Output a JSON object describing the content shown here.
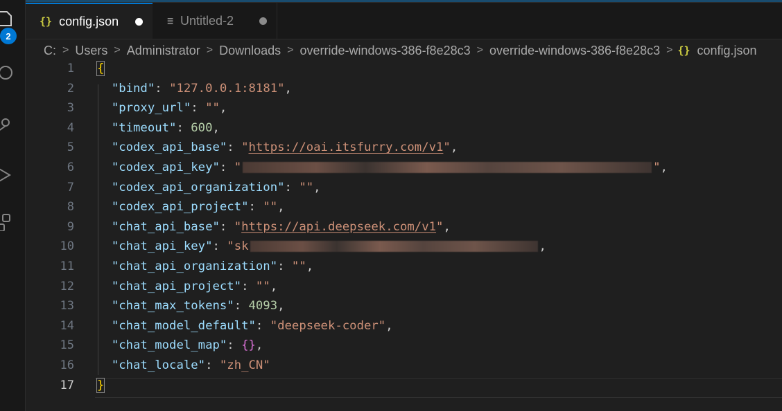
{
  "activity_bar": {
    "icons": [
      "explorer-icon",
      "search-icon",
      "source-control-icon",
      "run-debug-icon",
      "extensions-icon"
    ],
    "badge": "2",
    "accent_color": "#0078d4"
  },
  "tabs": [
    {
      "icon": "{}",
      "label": "config.json",
      "icon_color": "#cbcb41",
      "modified": true
    },
    {
      "icon": "≡",
      "label": "Untitled-2",
      "icon_color": "#8b8b8b",
      "modified": true
    }
  ],
  "breadcrumb": {
    "items": [
      "C:",
      "Users",
      "Administrator",
      "Downloads",
      "override-windows-386-f8e28c3",
      "override-windows-386-f8e28c3"
    ],
    "file_icon": "{}",
    "file": "config.json"
  },
  "editor": {
    "current_line": 17,
    "line_numbers": [
      "1",
      "2",
      "3",
      "4",
      "5",
      "6",
      "7",
      "8",
      "9",
      "10",
      "11",
      "12",
      "13",
      "14",
      "15",
      "16",
      "17"
    ],
    "open_brace": "{",
    "close_brace": "}",
    "entries": [
      {
        "key": "\"bind\"",
        "value": "\"127.0.0.1:8181\"",
        "type": "string"
      },
      {
        "key": "\"proxy_url\"",
        "value": "\"\"",
        "type": "string"
      },
      {
        "key": "\"timeout\"",
        "value": "600",
        "type": "number"
      },
      {
        "key": "\"codex_api_base\"",
        "value": "\"https://oai.itsfurry.com/v1\"",
        "type": "url"
      },
      {
        "key": "\"codex_api_key\"",
        "value_prefix": "\"",
        "value_suffix": "\"",
        "type": "redacted"
      },
      {
        "key": "\"codex_api_organization\"",
        "value": "\"\"",
        "type": "string"
      },
      {
        "key": "\"codex_api_project\"",
        "value": "\"\"",
        "type": "string"
      },
      {
        "key": "\"chat_api_base\"",
        "value": "\"https://api.deepseek.com/v1\"",
        "type": "url"
      },
      {
        "key": "\"chat_api_key\"",
        "value_prefix": "\"sk",
        "value_suffix": "",
        "type": "redacted"
      },
      {
        "key": "\"chat_api_organization\"",
        "value": "\"\"",
        "type": "string"
      },
      {
        "key": "\"chat_api_project\"",
        "value": "\"\"",
        "type": "string"
      },
      {
        "key": "\"chat_max_tokens\"",
        "value": "4093",
        "type": "number"
      },
      {
        "key": "\"chat_model_default\"",
        "value": "\"deepseek-coder\"",
        "type": "string"
      },
      {
        "key": "\"chat_model_map\"",
        "value": "{}",
        "type": "object"
      },
      {
        "key": "\"chat_locale\"",
        "value": "\"zh_CN\"",
        "type": "string"
      }
    ]
  }
}
